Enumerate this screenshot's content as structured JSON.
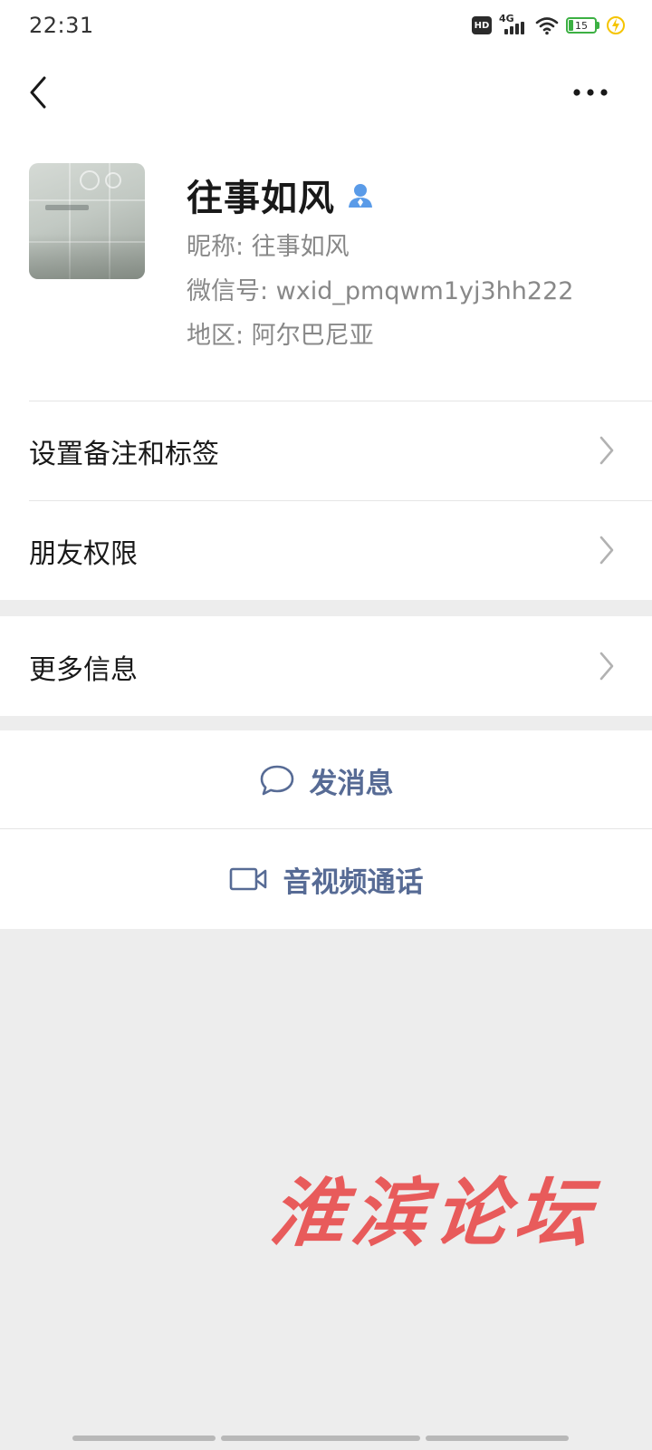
{
  "status_bar": {
    "time": "22:31",
    "hd": "HD",
    "network": "4G",
    "battery": "15"
  },
  "header": {
    "back_icon": "chevron-left-icon",
    "more_icon": "more-dots-icon"
  },
  "profile": {
    "name": "往事如风",
    "nickname": "昵称:  往事如风",
    "wechat_id": "微信号:  wxid_pmqwm1yj3hh222",
    "region": "地区:  阿尔巴尼亚",
    "contact_icon": "person-icon"
  },
  "menu": {
    "remark_tags": "设置备注和标签",
    "friend_permissions": "朋友权限",
    "more_info": "更多信息"
  },
  "actions": {
    "send_message": "发消息",
    "video_call": "音视频通话"
  },
  "watermark": "淮滨论坛",
  "colors": {
    "link": "#576b95",
    "background": "#ededed",
    "watermark": "#e85b5b",
    "contact_icon": "#5a9be8"
  }
}
